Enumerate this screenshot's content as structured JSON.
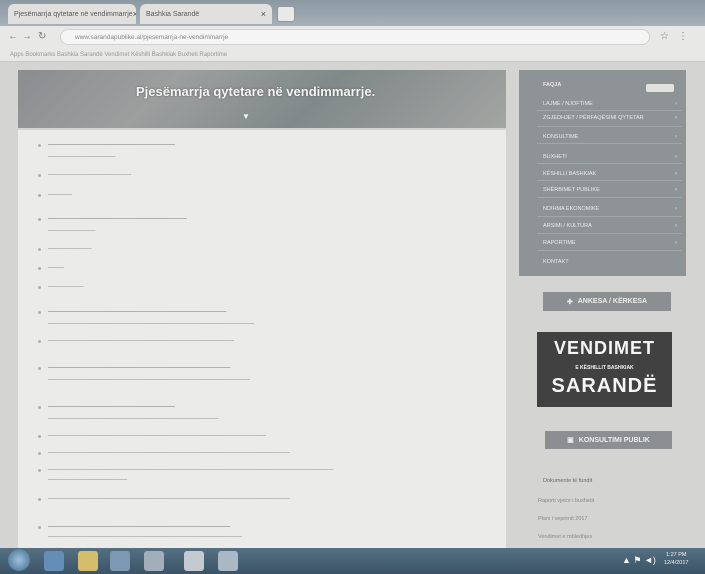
{
  "browser": {
    "tabs": [
      {
        "label": "Pjesëmarrja qytetare në vendimmarrje"
      },
      {
        "label": "Bashkia Sarandë"
      }
    ],
    "url": "www.sarandapublike.al/pjesemarrja-ne-vendimmarrje",
    "bookmarks": "Apps   Bookmarks   Bashkia Sarandë   Vendimet   Këshilli Bashkiak   Buxheti   Raportime"
  },
  "hero": {
    "title": "Pjesëmarrja qytetare në vendimmarrje."
  },
  "sidebar": {
    "menu_title": "FAQJA",
    "items": [
      {
        "label": "LAJME / NJOFTIME"
      },
      {
        "label": "ZGJEDHJET / PËRFAQËSIMI QYTETAR"
      },
      {
        "label": "KONSULTIME"
      },
      {
        "label": "BUXHETI"
      },
      {
        "label": "KËSHILLI BASHKIAK"
      },
      {
        "label": "SHËRBIMET PUBLIKE"
      },
      {
        "label": "NDIHMA EKONOMIKE"
      },
      {
        "label": "ARSIMI / KULTURA"
      },
      {
        "label": "RAPORTIME"
      },
      {
        "label": "KONTAKT"
      }
    ],
    "register_button": "ANKESA / KËRKESA",
    "vendimet": {
      "line1": "VENDIMET",
      "line2": "E KËSHILLIT BASHKIAK",
      "line3": "SARANDË"
    },
    "consult_button": "KONSULTIMI PUBLIK",
    "section_title": "Dokumente të fundit",
    "links": [
      "Raporti vjetor i buxhetit",
      "Plani i veprimit 2017",
      "Vendimet e mbledhjes"
    ]
  },
  "taskbar": {
    "time": "1:27 PM",
    "date": "12/4/2017"
  }
}
